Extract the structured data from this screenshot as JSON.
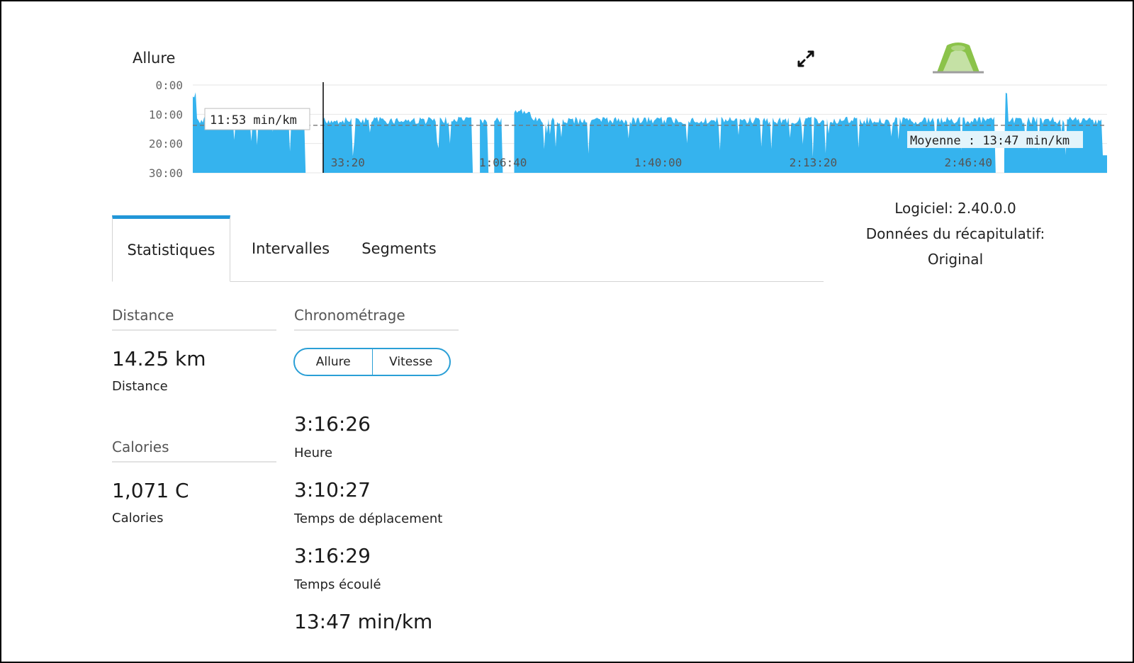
{
  "chart_data": {
    "type": "area",
    "title": "Allure",
    "y_ticks": [
      "0:00",
      "10:00",
      "20:00",
      "30:00"
    ],
    "x_ticks": [
      "33:20",
      "1:06:40",
      "1:40:00",
      "2:13:20",
      "2:46:40"
    ],
    "y_range_minutes": [
      0,
      30
    ],
    "x_range_seconds": [
      0,
      11789
    ],
    "y_inverted": true,
    "color": "#35b3ee",
    "average_label": "Moyenne : 13:47 min/km",
    "average_minutes": 13.78,
    "tooltip_label": "11:53 min/km",
    "tooltip_minutes": 11.88
  },
  "device": {
    "software": "Logiciel: 2.40.0.0",
    "summary_label": "Données du récapitulatif:",
    "summary_value": "Original"
  },
  "tabs": [
    "Statistiques",
    "Intervalles",
    "Segments"
  ],
  "stats": {
    "distance": {
      "title": "Distance",
      "value": "14.25 km",
      "label": "Distance"
    },
    "calories": {
      "title": "Calories",
      "value": "1,071 C",
      "label": "Calories"
    },
    "timing": {
      "title": "Chronométrage",
      "toggle": [
        "Allure",
        "Vitesse"
      ],
      "items": [
        {
          "value": "3:16:26",
          "label": "Heure"
        },
        {
          "value": "3:10:27",
          "label": "Temps de déplacement"
        },
        {
          "value": "3:16:29",
          "label": "Temps écoulé"
        },
        {
          "value": "13:47 min/km",
          "label": ""
        }
      ]
    }
  },
  "icons": {
    "expand": "expand-arrows-icon",
    "device": "watch-device-icon"
  }
}
